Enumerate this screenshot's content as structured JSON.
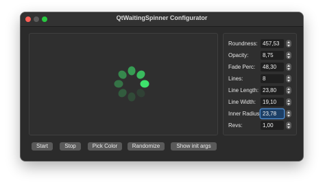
{
  "window": {
    "title": "QtWaitingSpinner Configurator"
  },
  "settings": [
    {
      "label": "Roundness:",
      "value": "457,53"
    },
    {
      "label": "Opacity:",
      "value": "8,75"
    },
    {
      "label": "Fade Perc:",
      "value": "48,30"
    },
    {
      "label": "Lines:",
      "value": "8"
    },
    {
      "label": "Line Length:",
      "value": "23,80"
    },
    {
      "label": "Line Width:",
      "value": "19,10"
    },
    {
      "label": "Inner Radius:",
      "value": "23,78"
    },
    {
      "label": "Revs:",
      "value": "1,00"
    }
  ],
  "buttons": {
    "start": "Start",
    "stop": "Stop",
    "pick_color": "Pick Color",
    "randomize": "Randomize",
    "show_init_args": "Show init args"
  },
  "spinner": {
    "color": "#3ee26c"
  }
}
